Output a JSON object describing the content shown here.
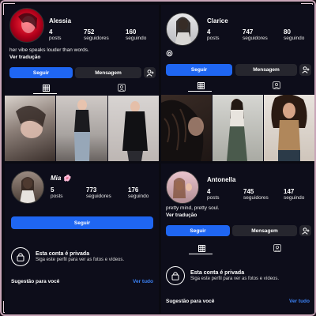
{
  "profiles": [
    {
      "username": "Alessia",
      "stats": [
        {
          "value": "4",
          "label": "posts"
        },
        {
          "value": "752",
          "label": "seguidores"
        },
        {
          "value": "160",
          "label": "seguindo"
        }
      ],
      "bio": "her vibe speaks louder than words.",
      "translate": "Ver tradução",
      "follow_label": "Seguir",
      "message_label": "Mensagem"
    },
    {
      "username": "Clarice",
      "stats": [
        {
          "value": "4",
          "label": "posts"
        },
        {
          "value": "747",
          "label": "seguidores"
        },
        {
          "value": "80",
          "label": "seguindo"
        }
      ],
      "follow_label": "Seguir",
      "message_label": "Mensagem"
    },
    {
      "username": "Mia 🌸",
      "stats": [
        {
          "value": "5",
          "label": "posts"
        },
        {
          "value": "773",
          "label": "seguidores"
        },
        {
          "value": "176",
          "label": "seguindo"
        }
      ],
      "follow_label": "Seguir",
      "private_title": "Esta conta é privada",
      "private_sub": "Siga este perfil para ver as fotos e vídeos.",
      "suggest_label": "Sugestão para você",
      "see_all": "Ver tudo"
    },
    {
      "username": "Antonella",
      "stats": [
        {
          "value": "4",
          "label": "posts"
        },
        {
          "value": "745",
          "label": "seguidores"
        },
        {
          "value": "147",
          "label": "seguindo"
        }
      ],
      "bio": "pretty mind, pretty soul.",
      "translate": "Ver tradução",
      "follow_label": "Seguir",
      "message_label": "Mensagem",
      "private_title": "Esta conta é privada",
      "private_sub": "Siga este perfil para ver as fotos e vídeos.",
      "suggest_label": "Sugestão para você",
      "see_all": "Ver tudo"
    }
  ],
  "icons": {
    "grid": "grid-icon",
    "tagged": "tagged-icon",
    "add_person": "add-person-icon",
    "lock": "lock-icon",
    "threads": "threads-icon"
  },
  "colors": {
    "accent": "#1f66f2",
    "link": "#3b82f6",
    "background": "#0d0d1a",
    "button_dark": "#26262e"
  }
}
